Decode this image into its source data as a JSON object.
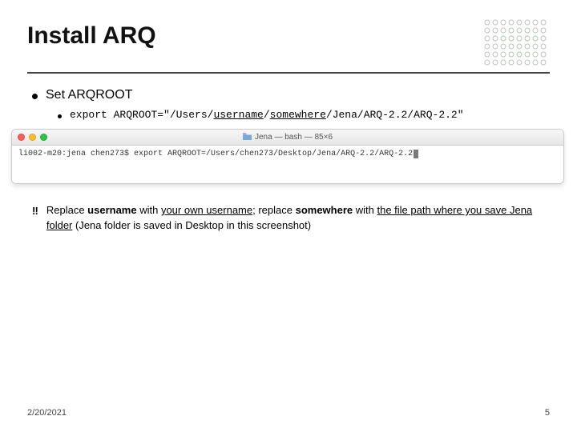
{
  "title": "Install ARQ",
  "bullet": {
    "label": "Set ARQROOT"
  },
  "sub": {
    "prefix": "export ARQROOT=\"/Users/",
    "username": "username",
    "mid1": "/",
    "somewhere": "somewhere",
    "suffix": "/Jena/ARQ-2.2/ARQ-2.2\""
  },
  "terminal": {
    "title": "Jena — bash — 85×6",
    "line": "li002-m20:jena chen273$ export ARQROOT=/Users/chen273/Desktop/Jena/ARQ-2.2/ARQ-2.2"
  },
  "note": {
    "marker": "‼",
    "p1": "Replace ",
    "p2": "username",
    "p3": " with ",
    "p4": "your own username",
    "p5": "; replace ",
    "p6": "somewhere",
    "p7": " with ",
    "p8": "the file path where you save Jena folder",
    "p9": " (Jena folder is saved in Desktop in this screenshot)"
  },
  "footer": {
    "date": "2/20/2021",
    "page": "5"
  }
}
